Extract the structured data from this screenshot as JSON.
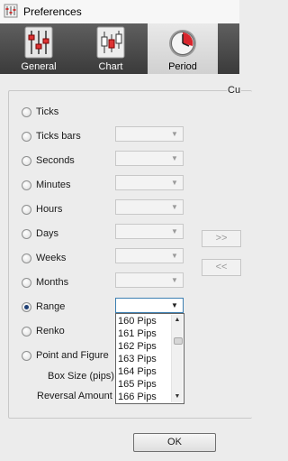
{
  "window": {
    "title": "Preferences"
  },
  "tabs": [
    {
      "label": "General",
      "icon": "sliders-icon"
    },
    {
      "label": "Chart",
      "icon": "candlestick-chart-icon"
    },
    {
      "label": "Period",
      "icon": "clock-icon",
      "active": true
    }
  ],
  "group": {
    "caption": "Cu"
  },
  "periods": [
    {
      "label": "Ticks",
      "selected": false
    },
    {
      "label": "Ticks bars",
      "selected": false
    },
    {
      "label": "Seconds",
      "selected": false
    },
    {
      "label": "Minutes",
      "selected": false
    },
    {
      "label": "Hours",
      "selected": false
    },
    {
      "label": "Days",
      "selected": false
    },
    {
      "label": "Weeks",
      "selected": false
    },
    {
      "label": "Months",
      "selected": false
    },
    {
      "label": "Range",
      "selected": true
    },
    {
      "label": "Renko",
      "selected": false
    },
    {
      "label": "Point and Figure",
      "selected": false
    }
  ],
  "dropdown": {
    "options": [
      "160 Pips",
      "161 Pips",
      "162 Pips",
      "163 Pips",
      "164 Pips",
      "165 Pips",
      "166 Pips"
    ]
  },
  "fields": {
    "box_size_label": "Box Size (pips)",
    "reversal_label": "Reversal Amount"
  },
  "buttons": {
    "add": ">>",
    "remove": "<<",
    "ok": "OK"
  },
  "colors": {
    "accent": "#3c7fb1",
    "tab_bar": "#4a4a4a",
    "selected_radio": "#1d3e74"
  }
}
